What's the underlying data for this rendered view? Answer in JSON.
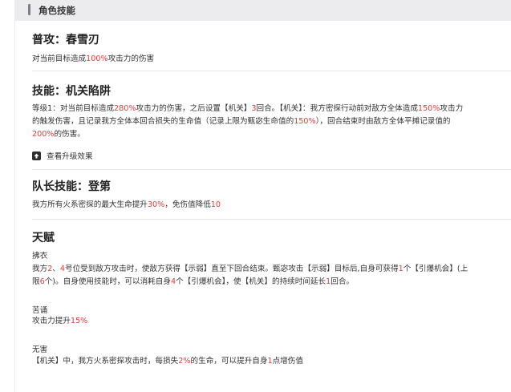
{
  "header": {
    "title": "角色技能"
  },
  "normal": {
    "title": "普攻：春雪刃",
    "desc": [
      "对当前目标造成",
      "100%",
      "攻击力的伤害"
    ]
  },
  "skill": {
    "title": "技能：机关陷阱",
    "line1": [
      "等级1：对当前目标造成",
      "280%",
      "攻击力的伤害，之后设置【机关】",
      "3",
      "回合。【机关】：我方密探行动前对敌方全体造成",
      "150%",
      "攻击力"
    ],
    "line2": [
      "的触发伤害，且记录我方全体本回合损失的生命值（记录上限为甄宓生命值的",
      "150%",
      "），回合结束时由敌方全体平摊记录值的"
    ],
    "line3": [
      "200%",
      "的伤害。"
    ],
    "upgrade_label": "查看升级效果"
  },
  "leader": {
    "title": "队长技能：登第",
    "desc": [
      "我方所有火系密探的最大生命提升",
      "30%",
      "，免伤值降低",
      "10"
    ]
  },
  "talent": {
    "title": "天赋",
    "t1": {
      "name": "拂衣",
      "line1": [
        "我方",
        "2",
        "、",
        "4",
        "号位受到敌方攻击时，使敌方获得【示弱】直至下回合结束。甄宓攻击【示弱】目标后,自身可获得",
        "1",
        "个【引爆机会】(上"
      ],
      "line2": [
        "限",
        "6",
        "个)。自身使用技能时，可以消耗自身",
        "4",
        "个【引爆机会】，使【机关】的持续时间延长",
        "1",
        "回合。"
      ]
    },
    "t2": {
      "name": "苦诵",
      "line": [
        "攻击力提升",
        "15%"
      ]
    },
    "t3": {
      "name": "无害",
      "line": [
        "【机关】中，我方火系密探攻击时，每损失",
        "2%",
        "的生命，可以提升自身",
        "1",
        "点增伤值"
      ]
    }
  },
  "colors": {
    "accent_red": "#e83a3a",
    "header_bg": "#ececee"
  }
}
